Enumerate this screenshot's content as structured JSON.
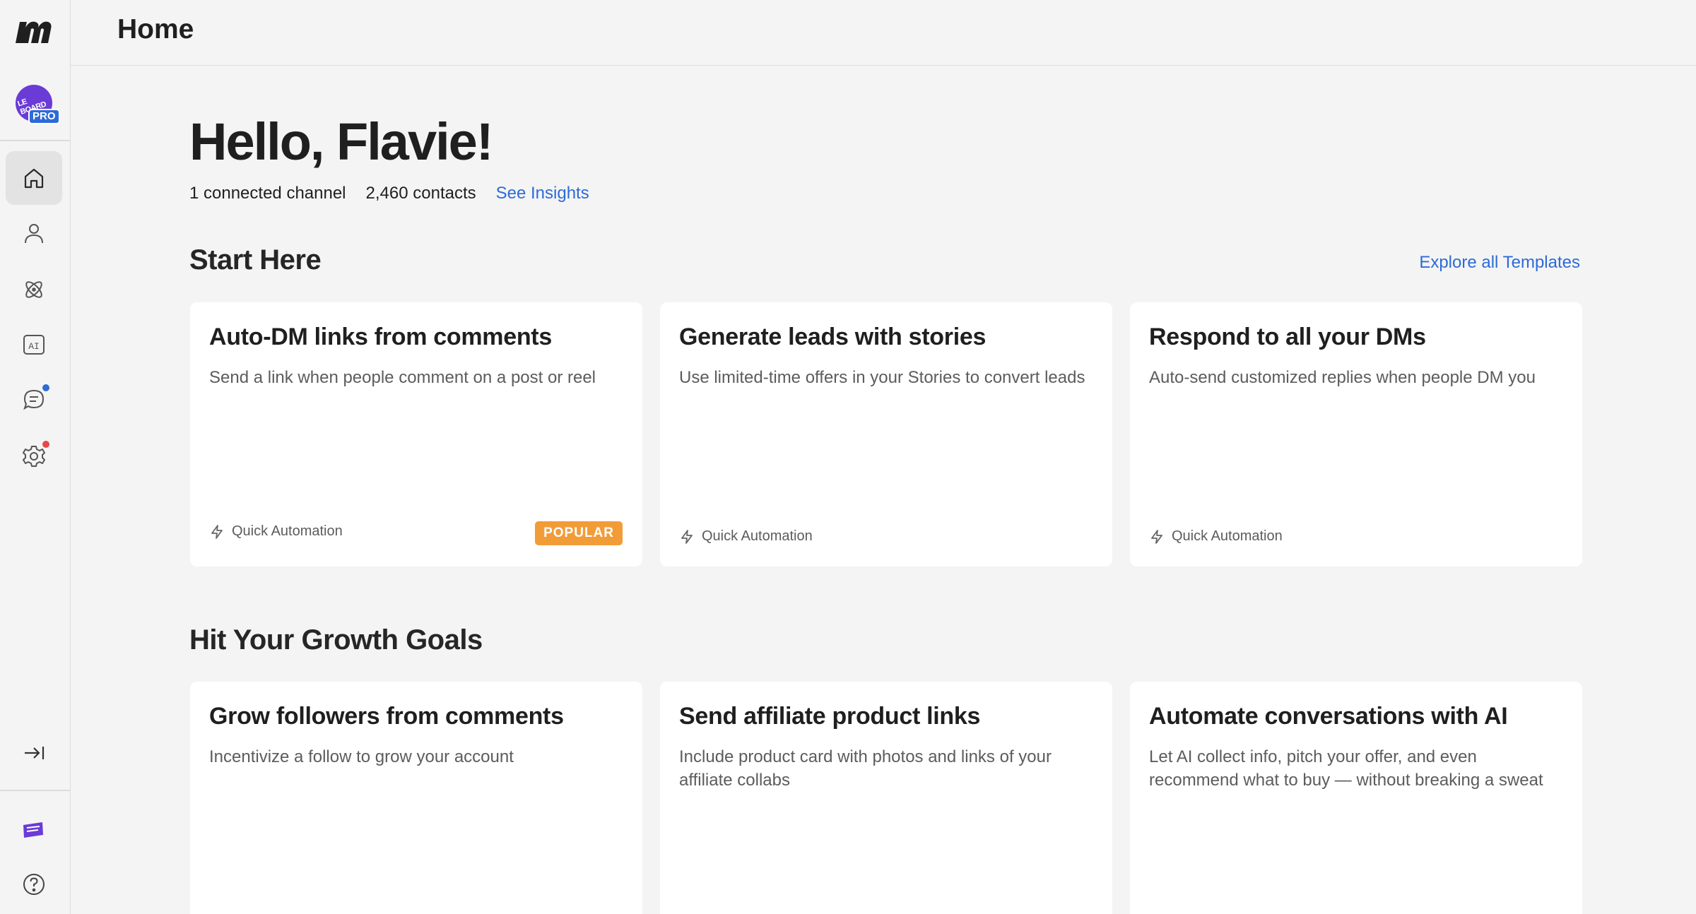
{
  "header": {
    "title": "Home"
  },
  "sidebar": {
    "avatar_text": "LE BOARD",
    "badge": "PRO",
    "items": [
      {
        "name": "home",
        "icon": "home-icon"
      },
      {
        "name": "contacts",
        "icon": "person-icon"
      },
      {
        "name": "automations",
        "icon": "atom-icon"
      },
      {
        "name": "ai",
        "icon": "ai-icon",
        "label": "AI"
      },
      {
        "name": "inbox",
        "icon": "chat-icon",
        "dot": "#2d6bd6"
      },
      {
        "name": "settings",
        "icon": "gear-icon",
        "dot": "#e54848"
      }
    ],
    "bottom": [
      {
        "name": "collapse",
        "icon": "collapse-right-icon"
      },
      {
        "name": "account",
        "icon": "account-logo-icon"
      },
      {
        "name": "help",
        "icon": "help-icon"
      }
    ]
  },
  "main": {
    "greeting": "Hello, Flavie!",
    "stats": {
      "channels": "1 connected channel",
      "contacts": "2,460 contacts",
      "insights_link": "See Insights"
    },
    "start_here": {
      "title": "Start Here",
      "explore_link": "Explore all Templates",
      "cards": [
        {
          "title": "Auto-DM links from comments",
          "desc": "Send a link when people comment on a post or reel",
          "type": "Quick Automation",
          "badge": "POPULAR"
        },
        {
          "title": "Generate leads with stories",
          "desc": "Use limited-time offers in your Stories to convert leads",
          "type": "Quick Automation"
        },
        {
          "title": "Respond to all your DMs",
          "desc": "Auto-send customized replies when people DM you",
          "type": "Quick Automation"
        }
      ]
    },
    "growth": {
      "title": "Hit Your Growth Goals",
      "cards": [
        {
          "title": "Grow followers from comments",
          "desc": "Incentivize a follow to grow your account"
        },
        {
          "title": "Send affiliate product links",
          "desc": "Include product card with photos and links of your affiliate collabs"
        },
        {
          "title": "Automate conversations with AI",
          "desc": "Let AI collect info, pitch your offer, and even recommend what to buy — without breaking a sweat"
        }
      ]
    }
  },
  "colors": {
    "accent": "#2d6bd6",
    "popular": "#f29c38",
    "alert": "#e54848"
  }
}
